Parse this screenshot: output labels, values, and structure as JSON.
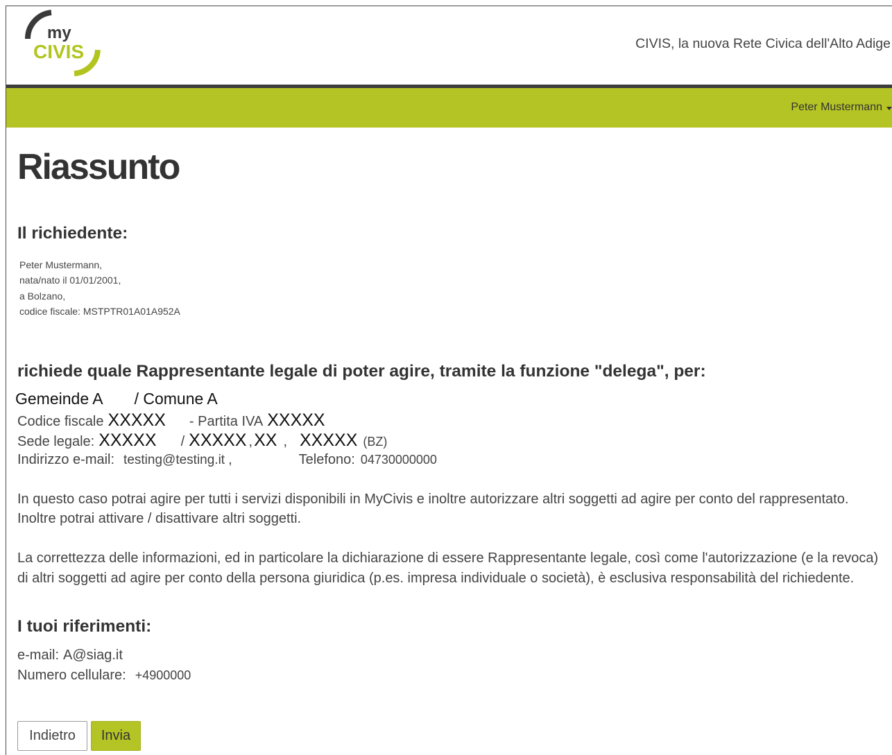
{
  "colors": {
    "brand_green": "#b4c424",
    "header_rule": "#3c3c3c"
  },
  "header": {
    "logo": {
      "text_my": "my",
      "text_civis": "CIVIS"
    },
    "tagline": "CIVIS, la nuova Rete Civica dell'Alto Adige"
  },
  "navbar": {
    "user_name": "Peter Mustermann",
    "user_menu_icon": "caret-down-icon"
  },
  "page": {
    "title": "Riassunto",
    "applicant": {
      "heading": "Il richiedente:",
      "lines": [
        "Peter Mustermann,",
        "nata/nato il 01/01/2001,",
        "a Bolzano,",
        "codice fiscale: MSTPTR01A01A952A"
      ]
    },
    "request": {
      "heading": "richiede quale Rappresentante legale di poter agire, tramite la funzione \"delega\", per:",
      "entity": {
        "name_de": "Gemeinde A",
        "name_it": "/ Comune A",
        "tax_code_label": "Codice fiscale",
        "tax_code": "XXXXX",
        "vat_label": "- Partita IVA",
        "vat_number": "XXXXX",
        "seat_label": "Sede legale:",
        "seat_part_1": "XXXXX",
        "seat_separator": "/",
        "seat_part_2": "XXXXX",
        "seat_comma_1": ",",
        "seat_part_3": "XX",
        "seat_comma_2": ",",
        "seat_part_4": "XXXXX",
        "seat_province": "(BZ)",
        "email_label": "Indirizzo e-mail:",
        "email": "testing@testing.it",
        "email_comma": ",",
        "phone_label": "Telefono:",
        "phone": "04730000000"
      }
    },
    "info_paragraphs": [
      {
        "lines": [
          "In questo caso potrai agire per tutti i servizi disponibili in MyCivis e inoltre autorizzare altri soggetti ad agire per conto del rappresentato.",
          "Inoltre potrai attivare / disattivare altri soggetti."
        ]
      },
      {
        "lines": [
          "La correttezza delle informazioni, ed in particolare la dichiarazione di essere Rappresentante legale, così come l'autorizzazione (e la revoca)",
          "di altri soggetti ad agire per conto della persona giuridica (p.es. impresa individuale o società), è esclusiva responsabilità del richiedente."
        ]
      }
    ],
    "references": {
      "heading": "I tuoi riferimenti:",
      "email_label": "e-mail:",
      "email": "A@siag.it",
      "mobile_label": "Numero cellulare:",
      "mobile": "+4900000"
    },
    "buttons": {
      "back": "Indietro",
      "submit": "Invia"
    }
  }
}
